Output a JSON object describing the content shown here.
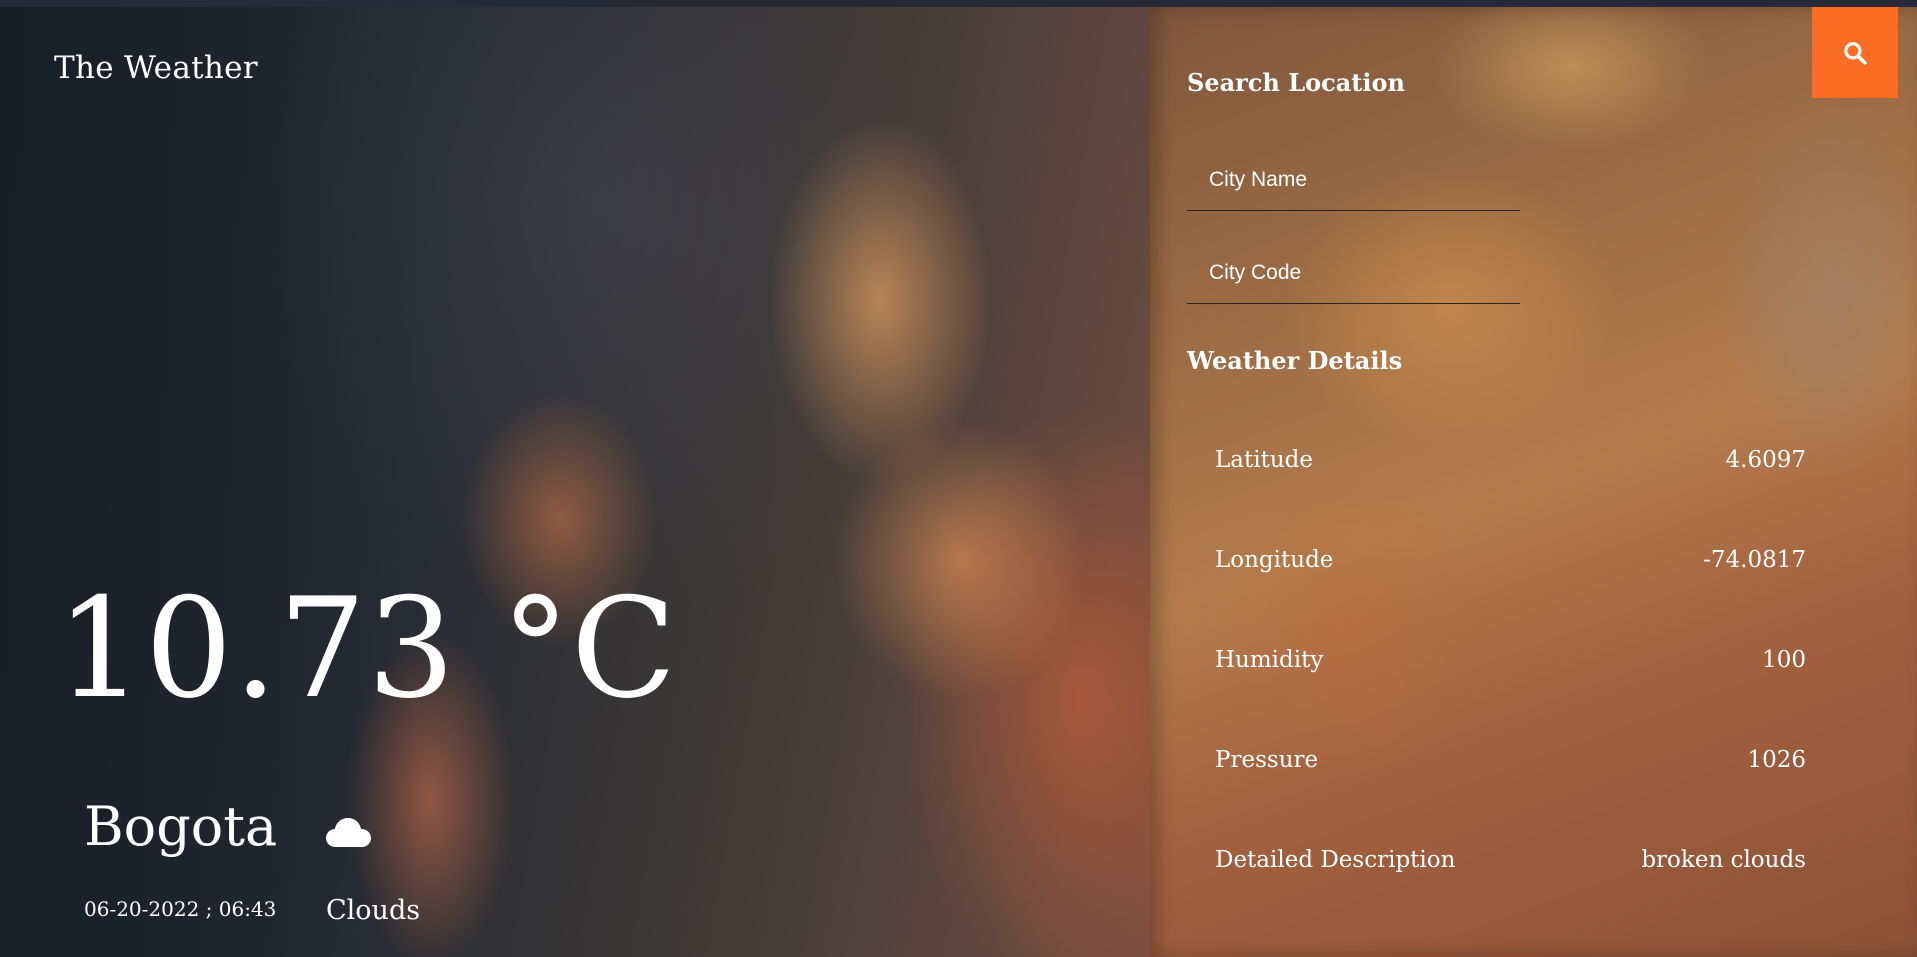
{
  "app": {
    "title": "The Weather"
  },
  "current": {
    "temperature": "10.73 °C",
    "city": "Bogota",
    "datetime": "06-20-2022 ; 06:43",
    "condition": "Clouds",
    "condition_icon": "cloud-icon"
  },
  "search": {
    "title": "Search Location",
    "city_name_placeholder": "City Name",
    "city_code_placeholder": "City Code",
    "button_icon": "search-icon"
  },
  "details": {
    "title": "Weather Details",
    "rows": [
      {
        "label": "Latitude",
        "value": "4.6097"
      },
      {
        "label": "Longitude",
        "value": "-74.0817"
      },
      {
        "label": "Humidity",
        "value": "100"
      },
      {
        "label": "Pressure",
        "value": "1026"
      },
      {
        "label": "Detailed Description",
        "value": "broken clouds"
      }
    ]
  },
  "colors": {
    "accent": "#fb6d23",
    "text": "#ffffff"
  }
}
